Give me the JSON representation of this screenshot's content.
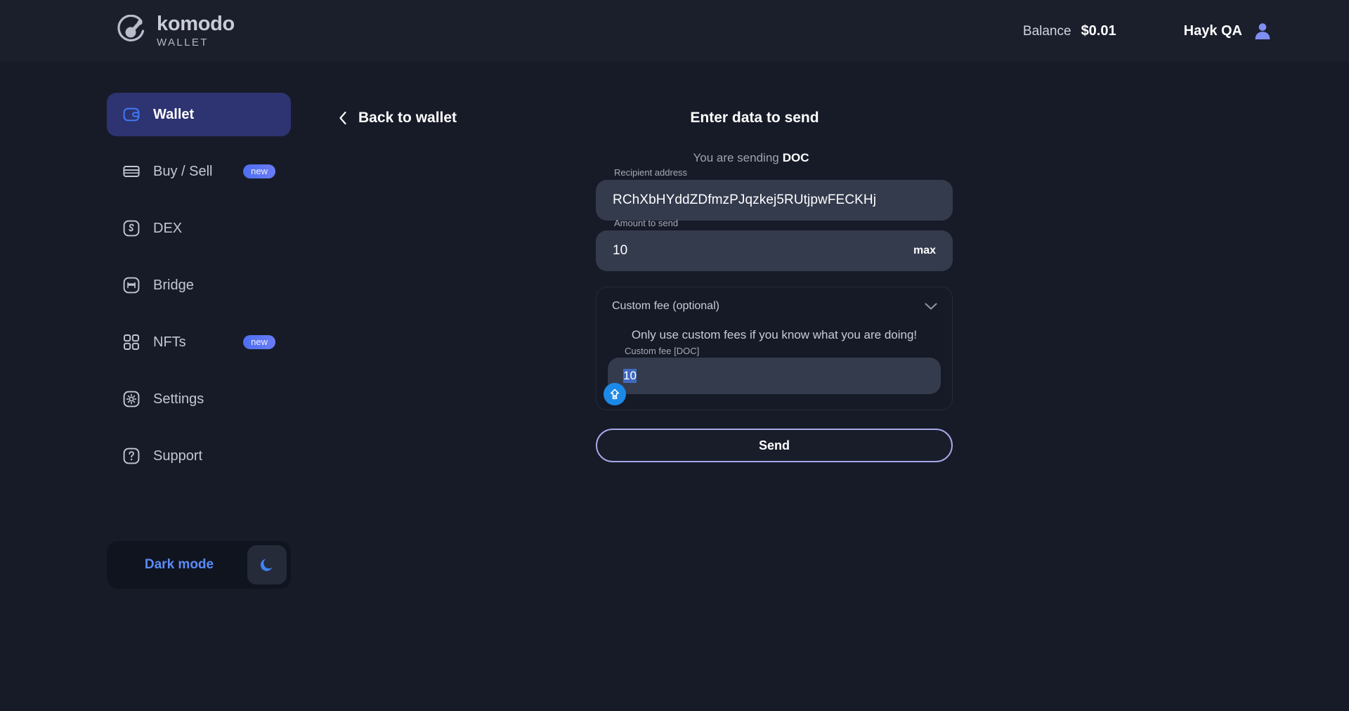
{
  "header": {
    "brand_name": "komodo",
    "brand_sub": "WALLET",
    "balance_label": "Balance",
    "balance_value": "$0.01",
    "user_name": "Hayk QA"
  },
  "sidebar": {
    "items": [
      {
        "label": "Wallet",
        "icon": "wallet-icon",
        "active": true,
        "badge": ""
      },
      {
        "label": "Buy / Sell",
        "icon": "card-icon",
        "active": false,
        "badge": "new"
      },
      {
        "label": "DEX",
        "icon": "swap-icon",
        "active": false,
        "badge": ""
      },
      {
        "label": "Bridge",
        "icon": "bridge-icon",
        "active": false,
        "badge": ""
      },
      {
        "label": "NFTs",
        "icon": "grid-icon",
        "active": false,
        "badge": "new"
      },
      {
        "label": "Settings",
        "icon": "gear-icon",
        "active": false,
        "badge": ""
      },
      {
        "label": "Support",
        "icon": "question-icon",
        "active": false,
        "badge": ""
      }
    ],
    "theme_toggle": {
      "label": "Dark mode",
      "icon": "moon-icon"
    }
  },
  "main": {
    "back_label": "Back to wallet",
    "back_icon": "chevron-left-icon",
    "title": "Enter data to send",
    "sending_prefix": "You are sending",
    "sending_ticker": "DOC",
    "recipient": {
      "label": "Recipient address",
      "value": "RChXbHYddZDfmzPJqzkej5RUtjpwFECKHj",
      "placeholder": "Recipient address"
    },
    "amount": {
      "label": "Amount to send",
      "value": "10",
      "placeholder": "Amount to send",
      "max_label": "max"
    },
    "custom_fee": {
      "header": "Custom fee (optional)",
      "chevron_icon": "chevron-down-icon",
      "warning": "Only use custom fees if you know what you are doing!",
      "field_label": "Custom fee [DOC]",
      "value": "10",
      "placeholder": "Custom fee [DOC]",
      "caps_icon": "caps-lock-icon"
    },
    "send_label": "Send"
  },
  "colors": {
    "background": "#171b27",
    "header_bg": "#1b1f2c",
    "accent_active": "#2e3371",
    "input_bg": "#343b4d",
    "badge_blue": "#4d6ff0",
    "send_border": "#a6a8e8",
    "moon_blue": "#3f84f5",
    "caps_blue": "#1c89e8"
  }
}
